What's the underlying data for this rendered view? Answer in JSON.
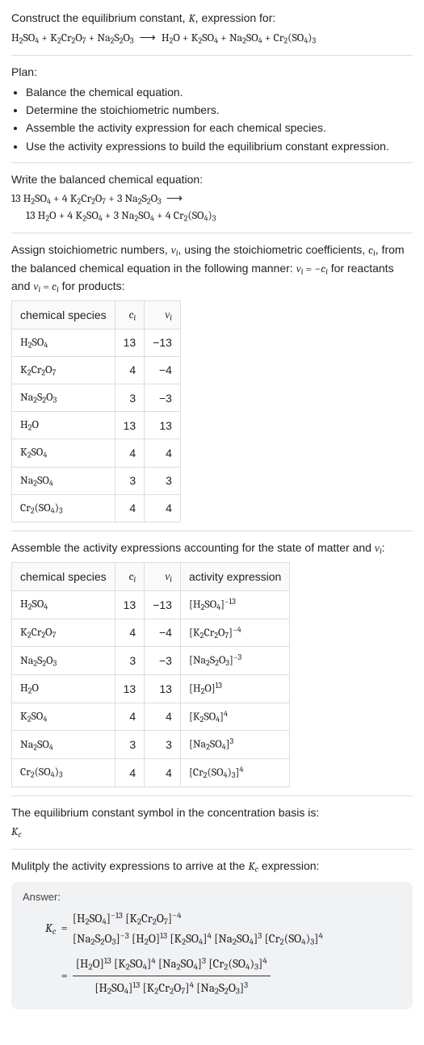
{
  "intro": {
    "line1": "Construct the equilibrium constant, K, expression for:",
    "equation_lhs": "H₂SO₄ + K₂Cr₂O₇ + Na₂S₂O₃",
    "arrow": "⟶",
    "equation_rhs": "H₂O + K₂SO₄ + Na₂SO₄ + Cr₂(SO₄)₃"
  },
  "plan": {
    "heading": "Plan:",
    "items": [
      "Balance the chemical equation.",
      "Determine the stoichiometric numbers.",
      "Assemble the activity expression for each chemical species.",
      "Use the activity expressions to build the equilibrium constant expression."
    ]
  },
  "balanced": {
    "heading": "Write the balanced chemical equation:",
    "line1": "13 H₂SO₄ + 4 K₂Cr₂O₇ + 3 Na₂S₂O₃  ⟶",
    "line2": "13 H₂O + 4 K₂SO₄ + 3 Na₂SO₄ + 4 Cr₂(SO₄)₃"
  },
  "stoich": {
    "heading": "Assign stoichiometric numbers, νᵢ, using the stoichiometric coefficients, cᵢ, from the balanced chemical equation in the following manner: νᵢ = −cᵢ for reactants and νᵢ = cᵢ for products:",
    "headers": [
      "chemical species",
      "cᵢ",
      "νᵢ"
    ],
    "rows": [
      {
        "sp": "H₂SO₄",
        "c": "13",
        "v": "−13"
      },
      {
        "sp": "K₂Cr₂O₇",
        "c": "4",
        "v": "−4"
      },
      {
        "sp": "Na₂S₂O₃",
        "c": "3",
        "v": "−3"
      },
      {
        "sp": "H₂O",
        "c": "13",
        "v": "13"
      },
      {
        "sp": "K₂SO₄",
        "c": "4",
        "v": "4"
      },
      {
        "sp": "Na₂SO₄",
        "c": "3",
        "v": "3"
      },
      {
        "sp": "Cr₂(SO₄)₃",
        "c": "4",
        "v": "4"
      }
    ]
  },
  "activity": {
    "heading": "Assemble the activity expressions accounting for the state of matter and νᵢ:",
    "headers": [
      "chemical species",
      "cᵢ",
      "νᵢ",
      "activity expression"
    ],
    "rows": [
      {
        "sp": "H₂SO₄",
        "c": "13",
        "v": "−13",
        "a": "[H₂SO₄]⁻¹³"
      },
      {
        "sp": "K₂Cr₂O₇",
        "c": "4",
        "v": "−4",
        "a": "[K₂Cr₂O₇]⁻⁴"
      },
      {
        "sp": "Na₂S₂O₃",
        "c": "3",
        "v": "−3",
        "a": "[Na₂S₂O₃]⁻³"
      },
      {
        "sp": "H₂O",
        "c": "13",
        "v": "13",
        "a": "[H₂O]¹³"
      },
      {
        "sp": "K₂SO₄",
        "c": "4",
        "v": "4",
        "a": "[K₂SO₄]⁴"
      },
      {
        "sp": "Na₂SO₄",
        "c": "3",
        "v": "3",
        "a": "[Na₂SO₄]³"
      },
      {
        "sp": "Cr₂(SO₄)₃",
        "c": "4",
        "v": "4",
        "a": "[Cr₂(SO₄)₃]⁴"
      }
    ]
  },
  "kc": {
    "line": "The equilibrium constant symbol in the concentration basis is:",
    "symbol": "K_c"
  },
  "multiply": {
    "line": "Mulitply the activity expressions to arrive at the K_c expression:"
  },
  "answer": {
    "label": "Answer:",
    "lhs": "K_c",
    "row1": "[H₂SO₄]⁻¹³ [K₂Cr₂O₇]⁻⁴",
    "row2": "[Na₂S₂O₃]⁻³ [H₂O]¹³ [K₂SO₄]⁴ [Na₂SO₄]³ [Cr₂(SO₄)₃]⁴",
    "frac_num": "[H₂O]¹³ [K₂SO₄]⁴ [Na₂SO₄]³ [Cr₂(SO₄)₃]⁴",
    "frac_den": "[H₂SO₄]¹³ [K₂Cr₂O₇]⁴ [Na₂S₂O₃]³"
  }
}
